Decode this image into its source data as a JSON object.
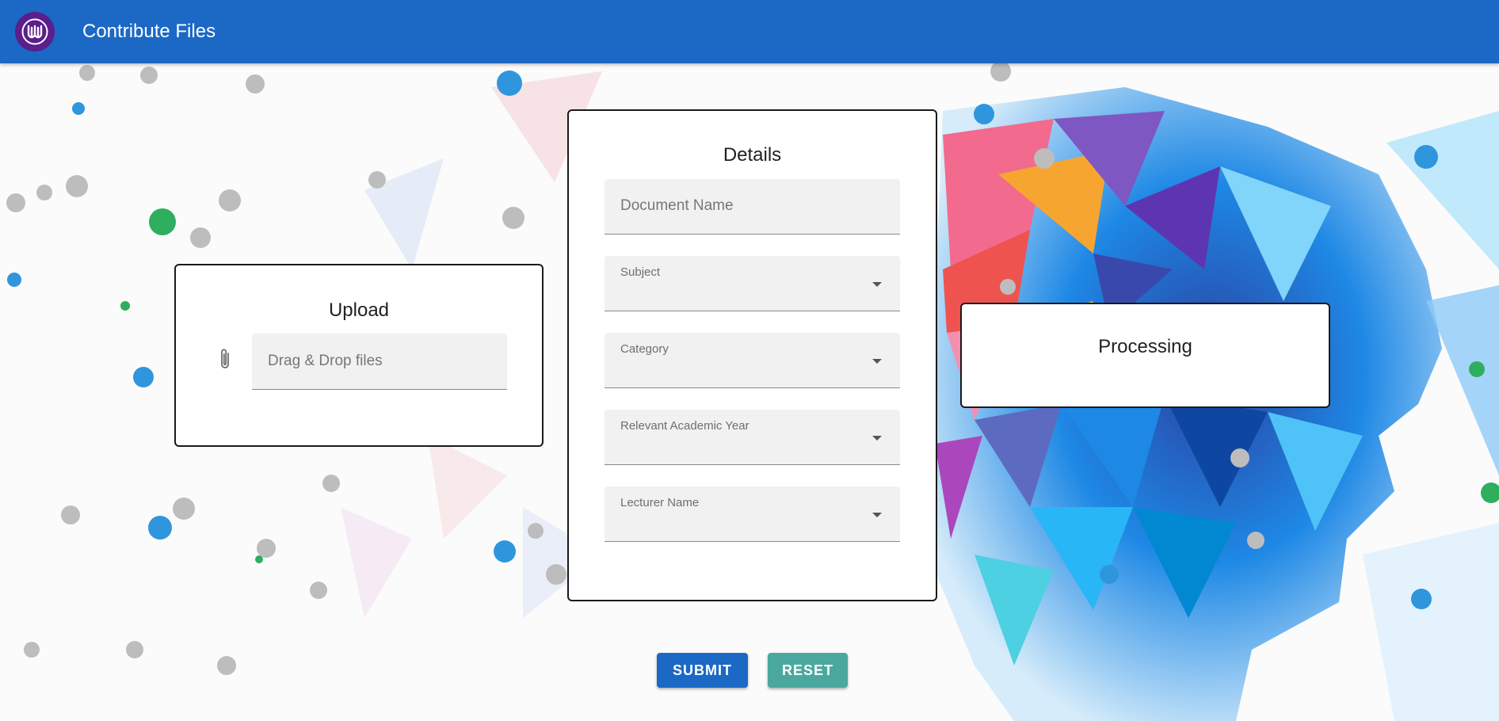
{
  "app": {
    "title": "Contribute Files"
  },
  "upload": {
    "title": "Upload",
    "placeholder": "Drag & Drop files"
  },
  "details": {
    "title": "Details",
    "document_name_placeholder": "Document Name",
    "subject_label": "Subject",
    "category_label": "Category",
    "academic_year_label": "Relevant Academic Year",
    "lecturer_label": "Lecturer Name"
  },
  "processing": {
    "title": "Processing"
  },
  "actions": {
    "submit_label": "SUBMIT",
    "reset_label": "RESET"
  },
  "colors": {
    "appbar": "#1b68c5",
    "logo": "#5b1e8c",
    "submit": "#1b68c5",
    "reset": "#4ba89e"
  },
  "icons": {
    "logo": "university-logo-icon",
    "attach": "paperclip-icon",
    "dropdown": "caret-down-icon"
  }
}
